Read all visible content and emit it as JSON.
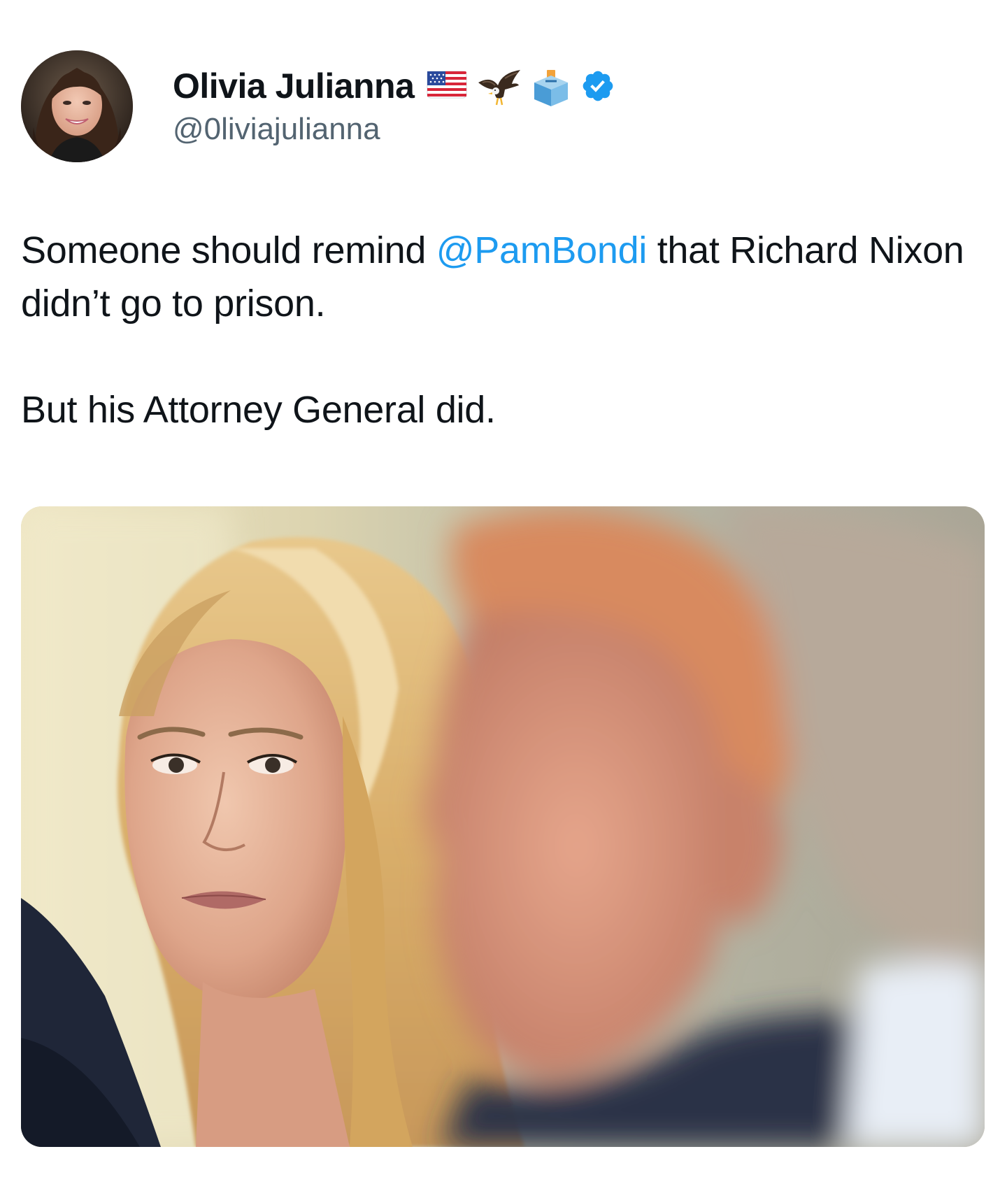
{
  "author": {
    "display_name": "Olivia Julianna",
    "handle": "@0liviajulianna",
    "badges": [
      "us-flag-icon",
      "eagle-icon",
      "ballot-box-icon",
      "verified-badge-icon"
    ],
    "verified_color": "#1d9bf0"
  },
  "tweet": {
    "text_before_mention": "Someone should remind ",
    "mention": "@PamBondi",
    "text_after_mention": " that Richard Nixon didn’t go to prison.",
    "second_paragraph": "But his Attorney General did.",
    "mention_color": "#1d9bf0"
  }
}
